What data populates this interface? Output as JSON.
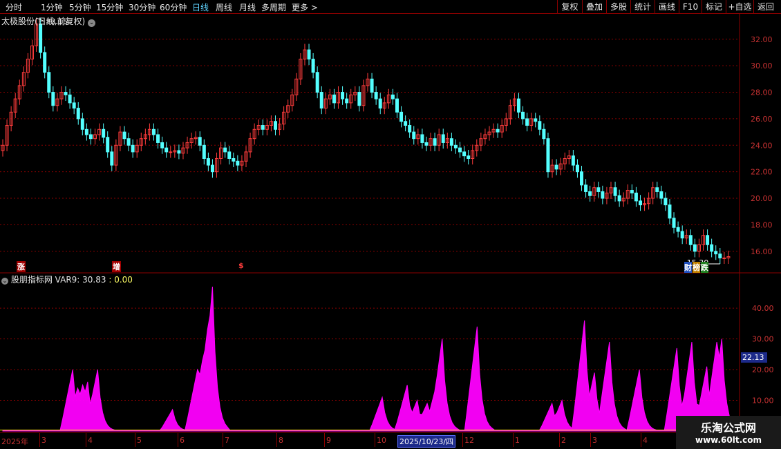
{
  "toolbar": {
    "periods": [
      "分时",
      "1分钟",
      "5分钟",
      "15分钟",
      "30分钟",
      "60分钟",
      "日线",
      "周线",
      "月线",
      "多周期",
      "更多 >"
    ],
    "active_period": "日线",
    "right_buttons": [
      "复权",
      "叠加",
      "多股",
      "统计",
      "画线",
      "F10",
      "标记",
      "+自选",
      "返回"
    ]
  },
  "main_panel": {
    "title": "太极股份(日线,前复权)",
    "high_label": "33.15",
    "low_label": "15.30",
    "price_ticks": [
      "32.00",
      "30.00",
      "28.00",
      "26.00",
      "24.00",
      "22.00",
      "20.00",
      "18.00",
      "16.00"
    ],
    "signals": {
      "zhang": "涨",
      "zeng": "增",
      "s": "$",
      "cai": "财",
      "bang": "榜",
      "die": "跌"
    }
  },
  "sub_panel": {
    "title": "股朋指标网",
    "var_label": "VAR9: 30.83",
    "var_extra": ": 0.00",
    "ticks": [
      "40.00",
      "30.00",
      "20.00",
      "10.00"
    ],
    "current_value": "22.13"
  },
  "date_axis": {
    "year_label": "2025年",
    "months": [
      "3",
      "4",
      "5",
      "6",
      "7",
      "8",
      "9",
      "10",
      "12",
      "1",
      "2",
      "3",
      "4"
    ],
    "highlight": "2025/10/23/四"
  },
  "watermark": {
    "line1": "乐淘公式网",
    "line2": "www.60lt.com"
  },
  "colors": {
    "up": "#ff3c3c",
    "down": "#54ffff",
    "indicator": "#ff00ff",
    "grid": "#8b0000"
  },
  "chart_data": {
    "type": "candlestick",
    "ylim": [
      15,
      33.5
    ],
    "closes": [
      24.0,
      25.5,
      26.5,
      27.5,
      28.5,
      29.5,
      30.5,
      31.5,
      33.15,
      31.0,
      29.5,
      28.0,
      27.0,
      27.5,
      28.0,
      27.8,
      27.2,
      26.8,
      26.0,
      25.2,
      24.8,
      24.5,
      24.8,
      25.2,
      24.6,
      23.5,
      22.5,
      24.0,
      25.0,
      24.5,
      24.0,
      23.5,
      24.0,
      24.5,
      24.8,
      25.2,
      24.8,
      24.2,
      23.8,
      23.5,
      23.5,
      23.6,
      23.4,
      23.8,
      24.2,
      24.5,
      24.6,
      24.0,
      23.0,
      22.5,
      22.0,
      23.0,
      23.8,
      23.5,
      23.0,
      22.8,
      22.5,
      22.8,
      23.5,
      24.5,
      25.2,
      25.5,
      25.2,
      25.5,
      25.8,
      25.2,
      25.6,
      26.5,
      27.0,
      27.8,
      29.0,
      30.5,
      31.2,
      30.5,
      29.5,
      28.0,
      26.8,
      27.5,
      27.8,
      27.2,
      28.0,
      27.5,
      27.2,
      27.8,
      28.0,
      27.0,
      28.5,
      29.0,
      28.0,
      27.5,
      26.8,
      27.2,
      27.8,
      27.5,
      26.5,
      25.8,
      25.5,
      25.0,
      24.5,
      24.8,
      24.2,
      24.0,
      24.5,
      24.0,
      24.8,
      24.2,
      24.5,
      24.0,
      23.8,
      23.5,
      23.2,
      23.0,
      23.6,
      24.0,
      24.5,
      24.8,
      25.0,
      25.2,
      25.0,
      25.5,
      26.0,
      27.0,
      27.5,
      26.5,
      26.0,
      25.5,
      26.0,
      25.8,
      25.2,
      24.5,
      22.0,
      22.5,
      22.2,
      22.6,
      23.0,
      23.2,
      22.5,
      22.0,
      21.0,
      20.5,
      20.2,
      20.8,
      20.5,
      20.0,
      20.4,
      20.8,
      20.2,
      19.8,
      20.0,
      20.6,
      20.4,
      19.8,
      19.5,
      19.6,
      20.0,
      20.8,
      20.5,
      20.0,
      19.5,
      18.5,
      17.8,
      17.5,
      17.0,
      17.2,
      16.5,
      16.0,
      16.5,
      17.2,
      16.5,
      16.0,
      15.8,
      15.5,
      15.5,
      15.6
    ]
  },
  "indicator_data": {
    "type": "area",
    "ylim": [
      0,
      47
    ],
    "peaks": [
      [
        28,
        20
      ],
      [
        30,
        14
      ],
      [
        32,
        15
      ],
      [
        34,
        16
      ],
      [
        38,
        20
      ],
      [
        68,
        7
      ],
      [
        78,
        20
      ],
      [
        80,
        23
      ],
      [
        82,
        33
      ],
      [
        84,
        47
      ],
      [
        152,
        11
      ],
      [
        162,
        15
      ],
      [
        166,
        10
      ],
      [
        170,
        9
      ],
      [
        174,
        16
      ],
      [
        176,
        30
      ],
      [
        190,
        34
      ],
      [
        220,
        9
      ],
      [
        224,
        10
      ],
      [
        233,
        36
      ],
      [
        237,
        19
      ],
      [
        243,
        29
      ],
      [
        255,
        20
      ],
      [
        270,
        27
      ],
      [
        276,
        29
      ],
      [
        282,
        21
      ],
      [
        286,
        29
      ],
      [
        288,
        30
      ]
    ],
    "n": 294
  }
}
